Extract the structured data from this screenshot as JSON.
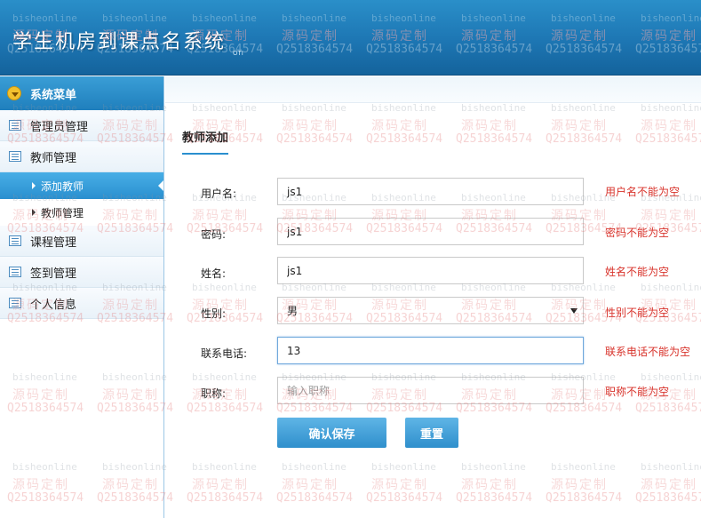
{
  "app": {
    "title": "学生机房到课点名系统",
    "title_sub": "OTI"
  },
  "sidebar": {
    "header_label": "系统菜单",
    "items": [
      {
        "label": "管理员管理"
      },
      {
        "label": "教师管理"
      },
      {
        "label": "添加教师",
        "sub": true,
        "active": true
      },
      {
        "label": "教师管理",
        "sub": true
      },
      {
        "label": "课程管理"
      },
      {
        "label": "签到管理"
      },
      {
        "label": "个人信息"
      }
    ]
  },
  "form": {
    "tab_title": "教师添加",
    "fields": {
      "username": {
        "label": "用户名:",
        "value": "js1",
        "error": "用户名不能为空"
      },
      "password": {
        "label": "密码:",
        "value": "js1",
        "error": "密码不能为空"
      },
      "name": {
        "label": "姓名:",
        "value": "js1",
        "error": "姓名不能为空"
      },
      "gender": {
        "label": "性别:",
        "value": "男",
        "error": "性别不能为空"
      },
      "phone": {
        "label": "联系电话:",
        "value": "13",
        "error": "联系电话不能为空"
      },
      "title": {
        "label": "职称:",
        "value": "",
        "placeholder": "输入职称",
        "error": "职称不能为空"
      }
    },
    "submit_label": "确认保存",
    "reset_label": "重置"
  },
  "watermark": {
    "line_a": "bisheonline",
    "line_b": "源码定制",
    "line_c": "Q2518364574"
  },
  "colors": {
    "accent": "#2a8fcf",
    "error": "#d8322a",
    "header": "#1d76b3"
  }
}
